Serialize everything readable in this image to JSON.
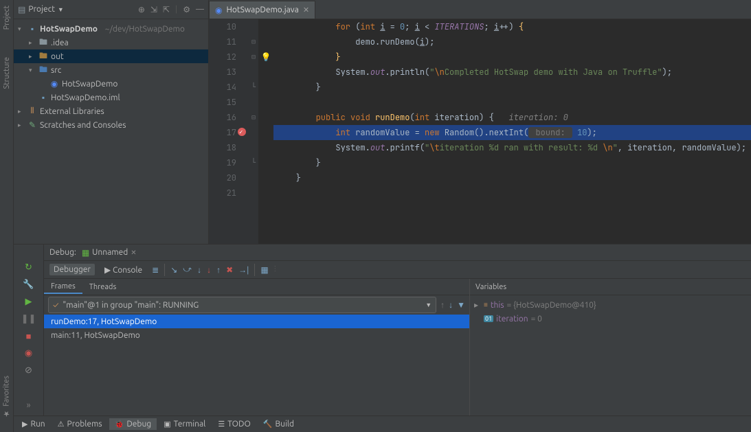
{
  "left_rail": {
    "items": [
      "Project",
      "Structure",
      "Favorites"
    ]
  },
  "project_header": {
    "title": "Project"
  },
  "tree": {
    "root_name": "HotSwapDemo",
    "root_path": "~/dev/HotSwapDemo",
    "idea_folder": ".idea",
    "out_folder": "out",
    "src_folder": "src",
    "class_name": "HotSwapDemo",
    "iml_name": "HotSwapDemo.iml",
    "ext_libs": "External Libraries",
    "scratches": "Scratches and Consoles"
  },
  "editor": {
    "tab_name": "HotSwapDemo.java",
    "lines": {
      "l10": "            for (int i = 0; i < ITERATIONS; i++) {",
      "l11": "                demo.runDemo(i);",
      "l12": "            }",
      "l13": "            System.out.println(\"\\nCompleted HotSwap demo with Java on Truffle\");",
      "l14": "        }",
      "l15": "",
      "l16_sig": "        public void runDemo(int iteration) {",
      "l16_hint": "iteration: 0",
      "l17_pre": "            int randomValue = new Random().nextInt(",
      "l17_hint": "bound:",
      "l17_hint_val": "10",
      "l17_post": ");",
      "l18": "            System.out.printf(\"\\titeration %d ran with result: %d \\n\", iteration, randomValue);",
      "l19": "        }",
      "l20": "    }",
      "l21": ""
    },
    "line_numbers": [
      "10",
      "11",
      "12",
      "13",
      "14",
      "15",
      "16",
      "17",
      "18",
      "19",
      "20",
      "21"
    ]
  },
  "debug": {
    "label": "Debug:",
    "config_name": "Unnamed",
    "tabs": {
      "debugger": "Debugger",
      "console": "Console"
    },
    "frames_tab": "Frames",
    "threads_tab": "Threads",
    "thread_text": "\"main\"@1 in group \"main\": RUNNING",
    "frames": [
      "runDemo:17, HotSwapDemo",
      "main:11, HotSwapDemo"
    ],
    "vars_header": "Variables",
    "vars": {
      "this_name": "this",
      "this_val": "= {HotSwapDemo@410}",
      "iter_name": "iteration",
      "iter_val": "= 0"
    }
  },
  "bottom_bar": {
    "run": "Run",
    "problems": "Problems",
    "debug": "Debug",
    "terminal": "Terminal",
    "todo": "TODO",
    "build": "Build"
  }
}
